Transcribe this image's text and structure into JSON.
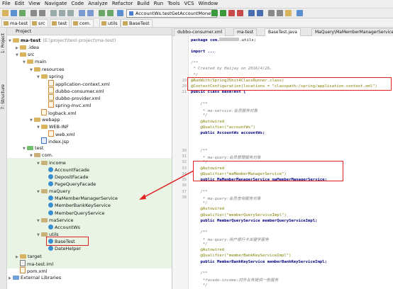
{
  "menu": [
    "File",
    "Edit",
    "View",
    "Navigate",
    "Code",
    "Analyze",
    "Refactor",
    "Build",
    "Run",
    "Tools",
    "VCS",
    "Window"
  ],
  "toolbar": {
    "run_config": "AccountWs.testGetAccountMoney"
  },
  "breadcrumbs": [
    "ma-test",
    "src",
    "test",
    "com.",
    "utils",
    "BaseTest"
  ],
  "sidebar_tabs": [
    "1: Project",
    "7: Structure"
  ],
  "project_panel": {
    "title": "Project",
    "tree": [
      {
        "label": "ma-test",
        "note": "(E:\\project\\test-project\\ma-test)",
        "indent": 0,
        "kind": "module",
        "open": true
      },
      {
        "label": ".idea",
        "indent": 1,
        "kind": "folder",
        "open": false
      },
      {
        "label": "src",
        "indent": 1,
        "kind": "folder",
        "open": true
      },
      {
        "label": "main",
        "indent": 2,
        "kind": "folder",
        "open": true
      },
      {
        "label": "resources",
        "indent": 3,
        "kind": "folder",
        "open": true
      },
      {
        "label": "spring",
        "indent": 4,
        "kind": "folder",
        "open": true
      },
      {
        "label": "application-context.xml",
        "indent": 5,
        "kind": "xml"
      },
      {
        "label": "dubbo-consumer.xml",
        "indent": 5,
        "kind": "xml"
      },
      {
        "label": "dubbo-provider.xml",
        "indent": 5,
        "kind": "xml"
      },
      {
        "label": "spring-mvc.xml",
        "indent": 5,
        "kind": "xml"
      },
      {
        "label": "logback.xml",
        "indent": 4,
        "kind": "xml"
      },
      {
        "label": "webapp",
        "indent": 3,
        "kind": "folder",
        "open": true
      },
      {
        "label": "WEB-INF",
        "indent": 4,
        "kind": "folder",
        "open": true
      },
      {
        "label": "web.xml",
        "indent": 5,
        "kind": "xml"
      },
      {
        "label": "index.jsp",
        "indent": 4,
        "kind": "jsp"
      },
      {
        "label": "test",
        "indent": 2,
        "kind": "test",
        "open": true
      },
      {
        "label": "com.",
        "indent": 3,
        "kind": "pkg",
        "open": true
      },
      {
        "label": "income",
        "indent": 4,
        "kind": "pkg",
        "open": true
      },
      {
        "label": "AccountFacade",
        "indent": 5,
        "kind": "class"
      },
      {
        "label": "DepositFacade",
        "indent": 5,
        "kind": "class"
      },
      {
        "label": "PageQueryFacade",
        "indent": 5,
        "kind": "class"
      },
      {
        "label": "maQuery",
        "indent": 4,
        "kind": "pkg",
        "open": true
      },
      {
        "label": "MaMemberManagerService",
        "indent": 5,
        "kind": "class"
      },
      {
        "label": "MemberBankKeyService",
        "indent": 5,
        "kind": "class"
      },
      {
        "label": "MemberQueryService",
        "indent": 5,
        "kind": "class"
      },
      {
        "label": "maService",
        "indent": 4,
        "kind": "pkg",
        "open": true
      },
      {
        "label": "AccountWs",
        "indent": 5,
        "kind": "class"
      },
      {
        "label": "utils",
        "indent": 4,
        "kind": "pkg",
        "open": true
      },
      {
        "label": "BaseTest",
        "indent": 5,
        "kind": "class"
      },
      {
        "label": "DateHelper",
        "indent": 5,
        "kind": "class"
      },
      {
        "label": "target",
        "indent": 1,
        "kind": "folder",
        "open": false
      },
      {
        "label": "ma-test.iml",
        "indent": 1,
        "kind": "iml"
      },
      {
        "label": "pom.xml",
        "indent": 1,
        "kind": "xml"
      },
      {
        "label": "External Libraries",
        "indent": 0,
        "kind": "lib",
        "open": false
      }
    ]
  },
  "editor": {
    "tabs": [
      {
        "label": "dubbo-consumer.xml",
        "active": false
      },
      {
        "label": "ma-test",
        "active": false
      },
      {
        "label": "BaseTest.java",
        "active": true
      },
      {
        "label": "MaQuery\\MaMemberManagerService",
        "active": false
      }
    ],
    "lines": [
      {
        "n": "",
        "t": "package com.",
        "x": ".utils;",
        "k": "pkg"
      },
      {
        "n": "",
        "t": "",
        "k": "blank"
      },
      {
        "n": "",
        "t": "import ...",
        "k": "imp"
      },
      {
        "n": "",
        "t": "",
        "k": "blank"
      },
      {
        "n": "",
        "t": "/**",
        "k": "cm"
      },
      {
        "n": "",
        "t": " * Created by Haijay on 2016/4/26.",
        "k": "cm"
      },
      {
        "n": "",
        "t": " */",
        "k": "cm"
      },
      {
        "n": "19",
        "t": "@RunWith(SpringJUnit4ClassRunner.class)",
        "k": "an"
      },
      {
        "n": "20",
        "t": "@ContextConfiguration(locations = \"classpath:/spring/application-context.xml\")",
        "k": "an"
      },
      {
        "n": "21",
        "t": "public class BaseTest {",
        "k": "decl"
      },
      {
        "n": "",
        "t": "",
        "k": "blank"
      },
      {
        "n": "",
        "t": "    /**",
        "k": "cm"
      },
      {
        "n": "",
        "t": "     * ma-service:会员服务对象",
        "k": "cm"
      },
      {
        "n": "",
        "t": "     */",
        "k": "cm"
      },
      {
        "n": "",
        "t": "    @Autowired",
        "k": "an"
      },
      {
        "n": "",
        "t": "    @Qualifier(\"accountWs\")",
        "k": "anq"
      },
      {
        "n": "",
        "t": "    public AccountWs accountWs;",
        "k": "decl"
      },
      {
        "n": "",
        "t": "",
        "k": "blank"
      },
      {
        "n": "",
        "t": "",
        "k": "blank"
      },
      {
        "n": "30",
        "t": "    /**",
        "k": "cm"
      },
      {
        "n": "31",
        "t": "     * ma-query:会员管理服务对象",
        "k": "cm"
      },
      {
        "n": "32",
        "t": "     */",
        "k": "cm"
      },
      {
        "n": "33",
        "t": "    @Autowired",
        "k": "an"
      },
      {
        "n": "34",
        "t": "    @Qualifier(\"maMemberManagerService\")",
        "k": "anq"
      },
      {
        "n": "35",
        "t": "    public MaMemberManagerService maMemberManagerService;",
        "k": "decl"
      },
      {
        "n": "36",
        "t": "",
        "k": "blank"
      },
      {
        "n": "37",
        "t": "    /**",
        "k": "cm"
      },
      {
        "n": "38",
        "t": "     * ma-query:会员查询服务对象",
        "k": "cm"
      },
      {
        "n": "",
        "t": "     */",
        "k": "cm"
      },
      {
        "n": "",
        "t": "    @Autowired",
        "k": "an"
      },
      {
        "n": "",
        "t": "    @Qualifier(\"memberQueryServiceImpl\")",
        "k": "anq"
      },
      {
        "n": "",
        "t": "    public MemberQueryService memberQueryServiceImpl;",
        "k": "decl"
      },
      {
        "n": "",
        "t": "",
        "k": "blank"
      },
      {
        "n": "",
        "t": "    /**",
        "k": "cm"
      },
      {
        "n": "",
        "t": "     * ma-query:用户银行卡关键字服务",
        "k": "cm"
      },
      {
        "n": "",
        "t": "     */",
        "k": "cm"
      },
      {
        "n": "",
        "t": "    @Autowired",
        "k": "an"
      },
      {
        "n": "",
        "t": "    @Qualifier(\"memberBankKeyServiceImpl\")",
        "k": "anq"
      },
      {
        "n": "",
        "t": "    public MemberBankKeyService memberBankKeyServiceImpl;",
        "k": "decl"
      },
      {
        "n": "",
        "t": "",
        "k": "blank"
      },
      {
        "n": "",
        "t": "    /**",
        "k": "cm"
      },
      {
        "n": "",
        "t": "     *facade-income:",
        "x": "对外业务提供一些服务",
        "k": "cmb"
      },
      {
        "n": "",
        "t": "     */",
        "k": "cm"
      }
    ]
  }
}
